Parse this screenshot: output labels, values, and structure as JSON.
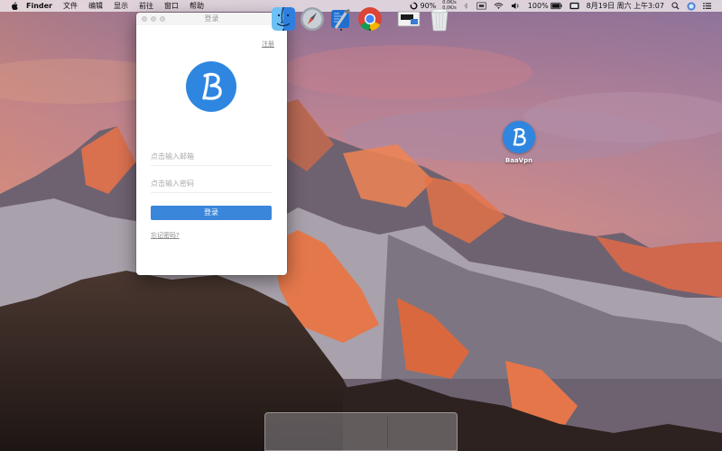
{
  "menubar": {
    "app_name": "Finder",
    "menus": [
      "文件",
      "编辑",
      "显示",
      "前往",
      "窗口",
      "帮助"
    ],
    "status": {
      "battery_ring": "90%",
      "net_up": "0.0K/s",
      "net_down": "0.0K/s",
      "battery": "100%",
      "datetime": "8月19日 周六 上午3:07"
    }
  },
  "login_window": {
    "title": "登录",
    "register_label": "注册",
    "logo_letter": "B",
    "email_placeholder": "点击输入邮箱",
    "password_placeholder": "点击输入密码",
    "login_button_label": "登录",
    "forgot_label": "忘记密码?"
  },
  "desktop": {
    "icon_letter": "B",
    "icon_label": "BaaVpn"
  },
  "dock": {
    "items": [
      "finder-icon",
      "launchpad-icon",
      "xcode-icon",
      "chrome-icon",
      "preview-icon",
      "trash-icon"
    ]
  },
  "colors": {
    "accent": "#2e86e0",
    "login_button": "#3a86db"
  }
}
